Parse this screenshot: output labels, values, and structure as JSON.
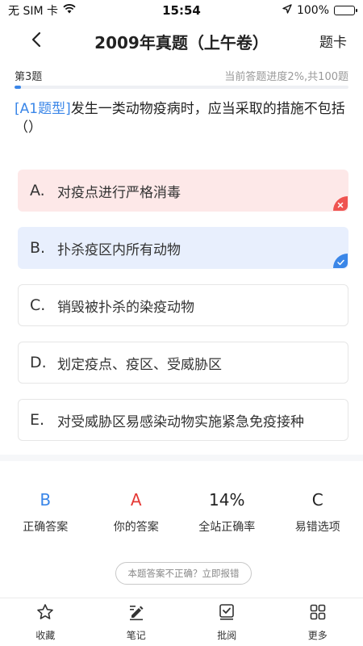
{
  "status_bar": {
    "carrier": "无 SIM 卡",
    "time": "15:54",
    "battery_percent": "100%",
    "battery_level": 1.0
  },
  "nav": {
    "back_icon": "chevron-left-icon",
    "title": "2009年真题（上午卷）",
    "right_label": "题卡"
  },
  "progress": {
    "question_index": "第3题",
    "progress_text": "当前答题进度2%,共100题",
    "fraction": 0.02
  },
  "question": {
    "type_tag": "[A1题型]",
    "text": "发生一类动物疫病时，应当采取的措施不包括（）"
  },
  "options": [
    {
      "letter": "A.",
      "text": "对疫点进行严格消毒",
      "state": "wrong"
    },
    {
      "letter": "B.",
      "text": "扑杀疫区内所有动物",
      "state": "correct"
    },
    {
      "letter": "C.",
      "text": "销毁被扑杀的染疫动物",
      "state": "normal"
    },
    {
      "letter": "D.",
      "text": "划定疫点、疫区、受威胁区",
      "state": "normal"
    },
    {
      "letter": "E.",
      "text": "对受威胁区易感染动物实施紧急免疫接种",
      "state": "normal"
    }
  ],
  "stats": {
    "correct_answer": {
      "value": "B",
      "label": "正确答案",
      "color": "#3a86e8"
    },
    "your_answer": {
      "value": "A",
      "label": "你的答案",
      "color": "#e53935"
    },
    "site_accuracy": {
      "value": "14%",
      "label": "全站正确率",
      "color": "#222222"
    },
    "error_prone": {
      "value": "C",
      "label": "易错选项",
      "color": "#222222"
    }
  },
  "report_button": "本题答案不正确？立即报错",
  "tabs": [
    {
      "label": "收藏",
      "icon": "star-icon"
    },
    {
      "label": "笔记",
      "icon": "note-edit-icon"
    },
    {
      "label": "批阅",
      "icon": "check-box-icon"
    },
    {
      "label": "更多",
      "icon": "grid-icon"
    }
  ],
  "colors": {
    "accent": "#3a86e8",
    "wrong_bg": "#fde8e8",
    "correct_bg": "#e8effd",
    "wrong_badge": "#ef5350"
  }
}
